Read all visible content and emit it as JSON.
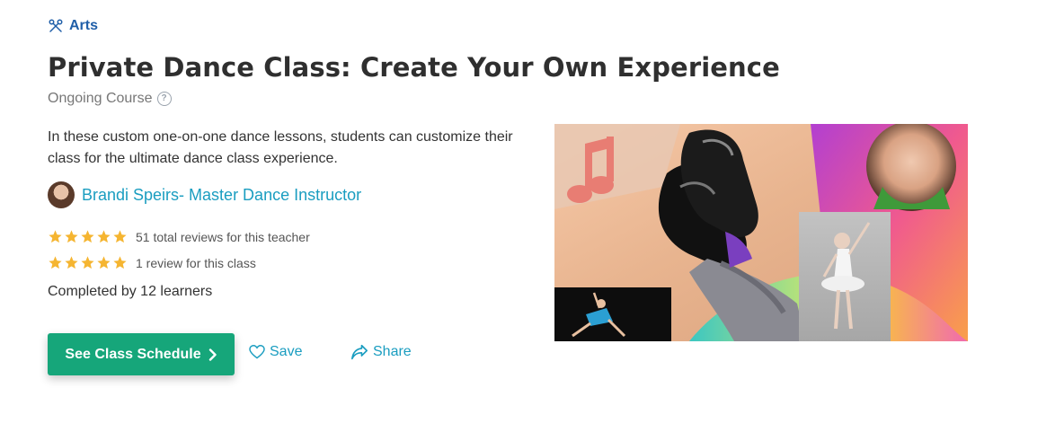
{
  "category": {
    "label": "Arts",
    "icon": "scissors-icon",
    "color": "#1f5ea8"
  },
  "title": "Private Dance Class: Create Your Own Experience",
  "course_type": "Ongoing Course",
  "description": "In these custom one-on-one dance lessons, students can customize their class for the ultimate dance class experience.",
  "teacher": {
    "name": "Brandi Speirs- Master Dance Instructor"
  },
  "reviews": [
    {
      "stars": 5,
      "text": "51 total reviews for this teacher"
    },
    {
      "stars": 5,
      "text": "1 review for this class"
    }
  ],
  "completed": "Completed by 12 learners",
  "actions": {
    "schedule_label": "See Class Schedule",
    "save_label": "Save",
    "share_label": "Share"
  },
  "colors": {
    "primary_button": "#16a67a",
    "link": "#1a9dc0",
    "star": "#f5b531"
  }
}
